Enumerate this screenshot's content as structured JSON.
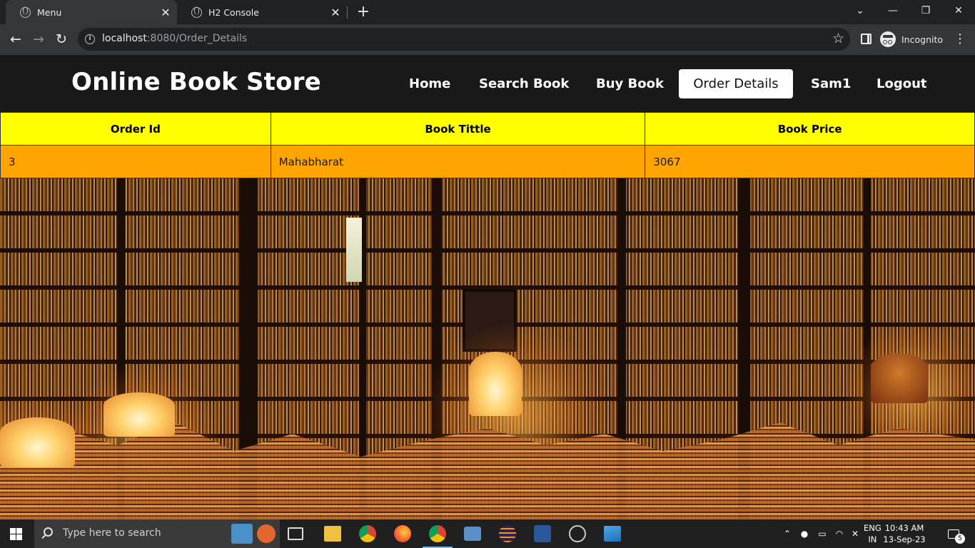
{
  "browser": {
    "tabs": [
      {
        "title": "Menu",
        "active": true
      },
      {
        "title": "H2 Console",
        "active": false
      }
    ],
    "url_host": "localhost",
    "url_rest": ":8080/Order_Details",
    "profile_label": "Incognito"
  },
  "site": {
    "brand": "Online Book Store",
    "nav": [
      {
        "label": "Home",
        "active": false
      },
      {
        "label": "Search Book",
        "active": false
      },
      {
        "label": "Buy Book",
        "active": false
      },
      {
        "label": "Order Details",
        "active": true
      },
      {
        "label": "Sam1",
        "active": false
      },
      {
        "label": "Logout",
        "active": false
      }
    ]
  },
  "orders": {
    "headers": [
      "Order Id",
      "Book Tittle",
      "Book Price"
    ],
    "rows": [
      [
        "3",
        "Mahabharat",
        "3067"
      ]
    ],
    "header_color": "#ffff00",
    "row_color": "#ffa500"
  },
  "taskbar": {
    "search_placeholder": "Type here to search",
    "apps": [
      "task-view-icon",
      "file-explorer-icon",
      "chrome-icon",
      "firefox-icon",
      "chrome-incognito-icon",
      "remote-desktop-icon",
      "eclipse-icon",
      "word-icon",
      "obs-icon",
      "photos-icon"
    ],
    "lang_line1": "ENG",
    "lang_line2": "IN",
    "time": "10:43 AM",
    "date": "13-Sep-23",
    "notification_count": "5"
  }
}
